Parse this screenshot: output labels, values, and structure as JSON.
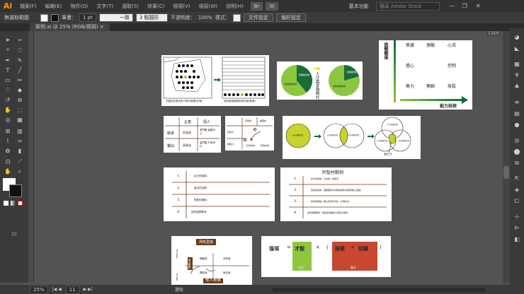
{
  "app": {
    "logo": "Ai",
    "menus": [
      "檔案(F)",
      "編輯(E)",
      "物件(O)",
      "文字(T)",
      "選取(S)",
      "效果(C)",
      "檢視(V)",
      "視窗(W)",
      "說明(H)"
    ],
    "workspace": "基本功能",
    "search_placeholder": "搜尋 Adobe Stock",
    "bridge": "Br",
    "stock": "St"
  },
  "control": {
    "selection": "無選取範圍",
    "stroke_label": "筆畫：",
    "stroke_value": "1 pt",
    "line_style": "一致",
    "brush": "3 點圓形",
    "opacity_label": "不透明度：",
    "opacity_value": "100%",
    "style_label": "樣式：",
    "doc_setup": "文件設定",
    "prefs": "偏好設定"
  },
  "tab": {
    "title": "案例.ai @ 25% (RGB/預視)",
    "close": "×"
  },
  "status": {
    "zoom": "25%",
    "artboard": "11",
    "mode": "選取"
  },
  "ruler": {
    "top_value": "1350"
  },
  "artboards": {
    "a1": {
      "left_caption": "不固定在原本的人群中就業(紅海)",
      "right_caption": "成為某個領域的佼佼者(藍海)"
    },
    "a2": {
      "left_big": "非我擅長領域",
      "left_small": "我擅長領域",
      "arrow_text": "人才需求隨時代",
      "right_big": "非我擅長領域",
      "right_small": "我擅長領域"
    },
    "a3": {
      "ylabel": "挑戰難度",
      "xlabel": "能力技術",
      "cells": [
        "焦慮",
        "激勵",
        "心流",
        "擔心",
        "控制",
        "無力",
        "無聊",
        "放鬆"
      ]
    },
    "a4": {
      "col1": "企業",
      "col2": "個人",
      "row1": "競爭",
      "row2": "獨佔",
      "c11": "低收益",
      "c12": "低門檻 誰都可以",
      "c21": "高收益",
      "c22": "高門檻 只有你行"
    },
    "a5": {
      "labels": [
        "有需求",
        "無需求",
        "有能力",
        "無能力",
        "紅海市場",
        "藍海市場"
      ]
    },
    "a6": {
      "c1": "自己想做的事",
      "c2a": "自己想做的事",
      "c2b": "對方想要的事",
      "c3a": "別人能做的事",
      "c3b": "自己想做的事",
      "c3c": "對方想要的事",
      "target": "理想工作"
    },
    "a7": {
      "rows": [
        {
          "n": "1.",
          "t": "自己的強項："
        },
        {
          "n": "2.",
          "t": "還沒的目標："
        },
        {
          "n": "3.",
          "t": "對象的煩惱："
        },
        {
          "n": "4.",
          "t": "如何回應需求："
        }
      ]
    },
    "a8": {
      "title": "阿智村範例",
      "rows": [
        {
          "n": "1.",
          "t": "自己的強項：日本第一的星空"
        },
        {
          "n": "2.",
          "t": "還沒的目標：首都圈和中京圈的遊客(週末和晚上過夜)"
        },
        {
          "n": "3.",
          "t": "對象的煩惱：難以找到好天氣、忙碌生活"
        },
        {
          "n": "4.",
          "t": "如何回應需求：推出夜間觀星之旅吸引遊客"
        }
      ]
    },
    "a9": {
      "title": "周哈里窗",
      "q1": "隱藏我",
      "q2": "未知我",
      "q3": "開放我",
      "q4": "盲目我",
      "left": "自己察覺",
      "bottom": "他人察覺",
      "side_top": "他人不知道",
      "side_bottom": "他人知道"
    },
    "a10": {
      "lhs": "強項",
      "eq": "=",
      "talent": "才能",
      "times": "×",
      "lp": "(",
      "skill": "技術",
      "plus": "+",
      "knowledge": "知識",
      "rp": ")",
      "innate": "先天",
      "acquired": "後天"
    }
  },
  "colors": {
    "green": "#8dc63f",
    "dark_green": "#1a6b3a",
    "red": "#c8472e",
    "brown": "#6b3a1a",
    "yellow": "#c8d42a"
  }
}
